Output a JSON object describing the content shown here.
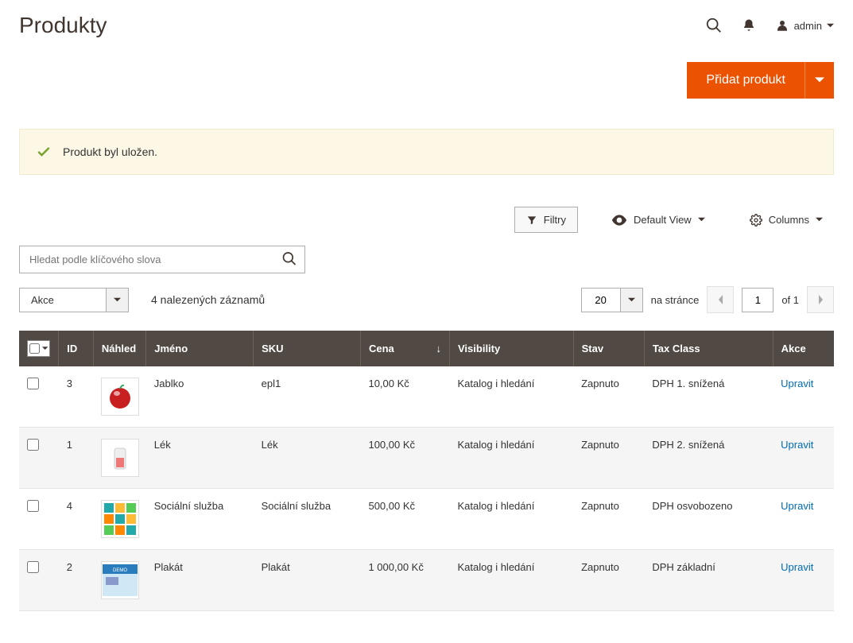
{
  "header": {
    "title": "Produkty",
    "user": "admin"
  },
  "actions": {
    "add_product": "Přidat produkt"
  },
  "message": {
    "text": "Produkt byl uložen."
  },
  "toolbar": {
    "filters": "Filtry",
    "default_view": "Default View",
    "columns": "Columns",
    "search_placeholder": "Hledat podle klíčového slova",
    "actions_label": "Akce",
    "records_found": "4 nalezených záznamů",
    "per_page_value": "20",
    "per_page_label": "na stránce",
    "page_current": "1",
    "page_of": "of 1"
  },
  "columns": {
    "id": "ID",
    "thumb": "Náhled",
    "name": "Jméno",
    "sku": "SKU",
    "price": "Cena",
    "visibility": "Visibility",
    "status": "Stav",
    "tax": "Tax Class",
    "action": "Akce"
  },
  "rows": [
    {
      "id": "3",
      "name": "Jablko",
      "sku": "epl1",
      "price": "10,00 Kč",
      "visibility": "Katalog i hledání",
      "status": "Zapnuto",
      "tax": "DPH 1. snížená",
      "action": "Upravit"
    },
    {
      "id": "1",
      "name": "Lék",
      "sku": "Lék",
      "price": "100,00 Kč",
      "visibility": "Katalog i hledání",
      "status": "Zapnuto",
      "tax": "DPH 2. snížená",
      "action": "Upravit"
    },
    {
      "id": "4",
      "name": "Sociální služba",
      "sku": "Sociální služba",
      "price": "500,00 Kč",
      "visibility": "Katalog i hledání",
      "status": "Zapnuto",
      "tax": "DPH osvobozeno",
      "action": "Upravit"
    },
    {
      "id": "2",
      "name": "Plakát",
      "sku": "Plakát",
      "price": "1 000,00 Kč",
      "visibility": "Katalog i hledání",
      "status": "Zapnuto",
      "tax": "DPH základní",
      "action": "Upravit"
    }
  ]
}
